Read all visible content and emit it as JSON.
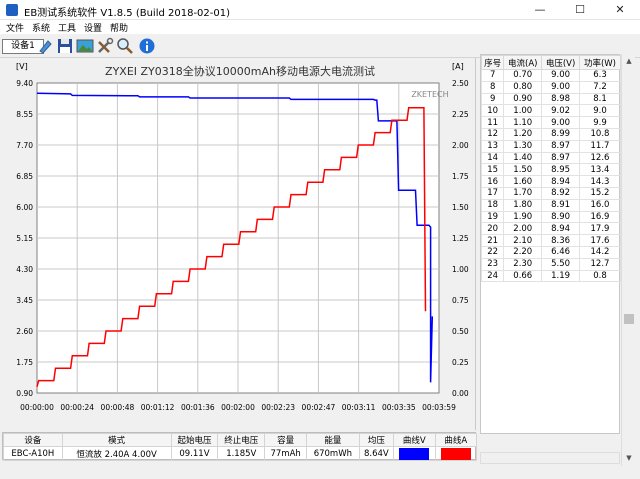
{
  "window": {
    "title": "EB测试系统软件 V1.8.5 (Build 2018-02-01)",
    "minimize": "—",
    "maximize": "☐",
    "close": "✕"
  },
  "menu": [
    "文件",
    "系统",
    "工具",
    "设置",
    "帮助"
  ],
  "toolbar": {
    "device_tab": "设备1",
    "icons": [
      "connect-icon",
      "save-icon",
      "image-icon",
      "tools-icon",
      "zoom-icon",
      "info-icon"
    ]
  },
  "chart_data": {
    "type": "line",
    "title": "ZYXEI ZY0318全协议10000mAh移动电源大电流测试",
    "watermark": "ZKETECH",
    "left_unit": "[V]",
    "right_unit": "[A]",
    "y_left_ticks": [
      "9.40",
      "8.55",
      "7.70",
      "6.85",
      "6.00",
      "5.15",
      "4.30",
      "3.45",
      "2.60",
      "1.75",
      "0.90"
    ],
    "y_right_ticks": [
      "2.50",
      "2.25",
      "2.00",
      "1.75",
      "1.50",
      "1.25",
      "1.00",
      "0.75",
      "0.50",
      "0.25",
      "0.00"
    ],
    "x_ticks": [
      "00:00:00",
      "00:00:24",
      "00:00:48",
      "00:01:12",
      "00:01:36",
      "00:02:00",
      "00:02:23",
      "00:02:47",
      "00:03:11",
      "00:03:35",
      "00:03:59"
    ],
    "ylim_left": [
      0.9,
      9.4
    ],
    "ylim_right": [
      0.0,
      2.5
    ],
    "xlim": [
      0,
      239
    ],
    "series": [
      {
        "axis": "left",
        "color": "#0000ff",
        "points": [
          [
            0,
            9.12
          ],
          [
            20,
            9.1
          ],
          [
            21,
            9.06
          ],
          [
            60,
            9.05
          ],
          [
            61,
            9.02
          ],
          [
            90,
            9.02
          ],
          [
            91,
            8.99
          ],
          [
            150,
            8.99
          ],
          [
            151,
            8.95
          ],
          [
            200,
            8.95
          ],
          [
            201,
            8.93
          ],
          [
            202,
            8.93
          ],
          [
            203,
            8.36
          ],
          [
            214,
            8.36
          ],
          [
            215,
            6.46
          ],
          [
            225,
            6.46
          ],
          [
            226,
            5.5
          ],
          [
            233,
            5.5
          ],
          [
            234,
            5.45
          ],
          [
            234,
            1.19
          ],
          [
            235,
            3.0
          ]
        ]
      },
      {
        "axis": "right",
        "color": "#ff0000",
        "points": [
          [
            0,
            0.05
          ],
          [
            1,
            0.1
          ],
          [
            10,
            0.1
          ],
          [
            11,
            0.2
          ],
          [
            20,
            0.2
          ],
          [
            21,
            0.3
          ],
          [
            30,
            0.3
          ],
          [
            31,
            0.4
          ],
          [
            40,
            0.4
          ],
          [
            41,
            0.5
          ],
          [
            50,
            0.5
          ],
          [
            51,
            0.6
          ],
          [
            60,
            0.6
          ],
          [
            61,
            0.7
          ],
          [
            70,
            0.7
          ],
          [
            71,
            0.8
          ],
          [
            80,
            0.8
          ],
          [
            81,
            0.9
          ],
          [
            90,
            0.9
          ],
          [
            91,
            1.0
          ],
          [
            100,
            1.0
          ],
          [
            101,
            1.1
          ],
          [
            110,
            1.1
          ],
          [
            111,
            1.2
          ],
          [
            120,
            1.2
          ],
          [
            121,
            1.3
          ],
          [
            130,
            1.3
          ],
          [
            131,
            1.4
          ],
          [
            140,
            1.4
          ],
          [
            141,
            1.5
          ],
          [
            150,
            1.5
          ],
          [
            151,
            1.6
          ],
          [
            160,
            1.6
          ],
          [
            161,
            1.7
          ],
          [
            170,
            1.7
          ],
          [
            171,
            1.8
          ],
          [
            180,
            1.8
          ],
          [
            181,
            1.9
          ],
          [
            190,
            1.9
          ],
          [
            191,
            2.0
          ],
          [
            200,
            2.0
          ],
          [
            201,
            2.1
          ],
          [
            210,
            2.1
          ],
          [
            211,
            2.2
          ],
          [
            220,
            2.2
          ],
          [
            221,
            2.3
          ],
          [
            230,
            2.3
          ],
          [
            231,
            0.66
          ]
        ]
      }
    ]
  },
  "side_table": {
    "headers": [
      "序号",
      "电流(A)",
      "电压(V)",
      "功率(W)"
    ],
    "rows": [
      [
        "7",
        "0.70",
        "9.00",
        "6.3"
      ],
      [
        "8",
        "0.80",
        "9.00",
        "7.2"
      ],
      [
        "9",
        "0.90",
        "8.98",
        "8.1"
      ],
      [
        "10",
        "1.00",
        "9.02",
        "9.0"
      ],
      [
        "11",
        "1.10",
        "9.00",
        "9.9"
      ],
      [
        "12",
        "1.20",
        "8.99",
        "10.8"
      ],
      [
        "13",
        "1.30",
        "8.97",
        "11.7"
      ],
      [
        "14",
        "1.40",
        "8.97",
        "12.6"
      ],
      [
        "15",
        "1.50",
        "8.95",
        "13.4"
      ],
      [
        "16",
        "1.60",
        "8.94",
        "14.3"
      ],
      [
        "17",
        "1.70",
        "8.92",
        "15.2"
      ],
      [
        "18",
        "1.80",
        "8.91",
        "16.0"
      ],
      [
        "19",
        "1.90",
        "8.90",
        "16.9"
      ],
      [
        "20",
        "2.00",
        "8.94",
        "17.9"
      ],
      [
        "21",
        "2.10",
        "8.36",
        "17.6"
      ],
      [
        "22",
        "2.20",
        "6.46",
        "14.2"
      ],
      [
        "23",
        "2.30",
        "5.50",
        "12.7"
      ],
      [
        "24",
        "0.66",
        "1.19",
        "0.8"
      ]
    ]
  },
  "bottom_table": {
    "headers": [
      "设备",
      "模式",
      "起始电压",
      "终止电压",
      "容量",
      "能量",
      "均压",
      "曲线V",
      "曲线A"
    ],
    "row": [
      "EBC-A10H",
      "恒流放  2.40A  4.00V",
      "09.11V",
      "1.185V",
      "77mAh",
      "670mWh",
      "8.64V"
    ]
  },
  "colors": {
    "voltage": "#0000ff",
    "current": "#ff0000"
  }
}
